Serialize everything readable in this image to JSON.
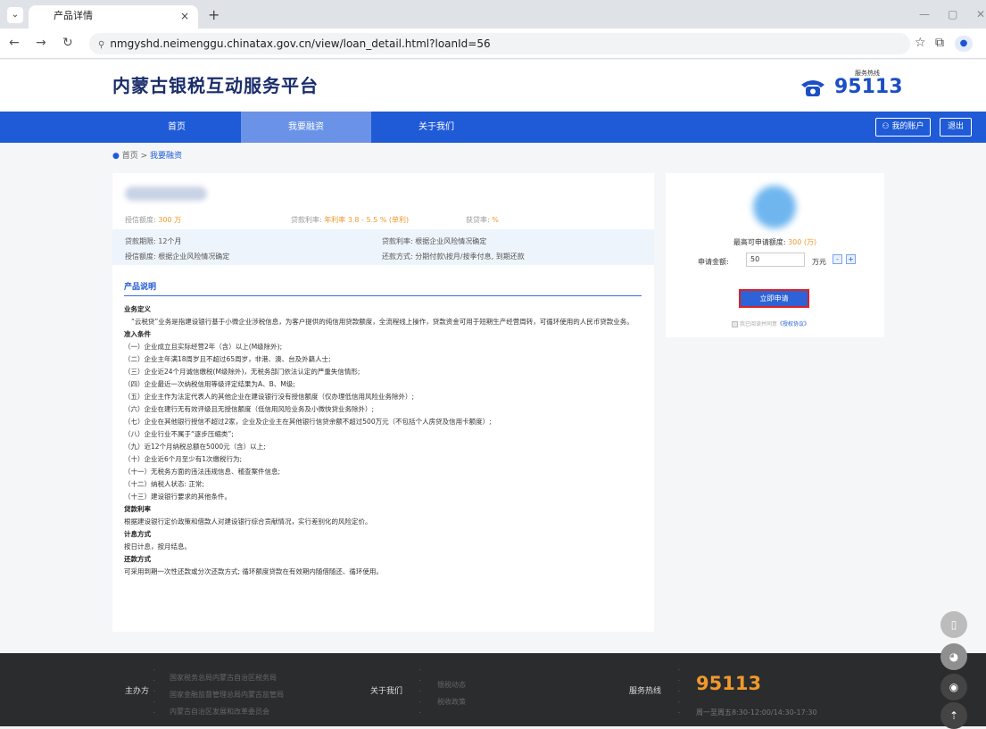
{
  "browser": {
    "tab_title": "产品详情",
    "tab_close": "×",
    "new_tab": "+",
    "url": "nmgyshd.neimenggu.chinatax.gov.cn/view/loan_detail.html?loanId=56"
  },
  "header": {
    "site_title": "内蒙古银税互动服务平台",
    "hotline_label": "服务热线",
    "hotline_number": "95113"
  },
  "nav": {
    "items": [
      "首页",
      "我要融资",
      "关于我们"
    ],
    "account": "我的账户",
    "logout": "退出"
  },
  "breadcrumb": {
    "home": "首页",
    "sep": ">",
    "current": "我要融资"
  },
  "product": {
    "stats": [
      {
        "label": "授信额度: ",
        "value": "300 万"
      },
      {
        "label": "贷款利率: ",
        "value": "年利率 3.8 - 5.5 % (单利)"
      },
      {
        "label": "获贷率: ",
        "value": "%"
      }
    ],
    "info": {
      "term": "贷款期限: 12个月",
      "rate": "贷款利率: 根据企业风险情况确定",
      "credit": "授信额度: 根据企业风险情况确定",
      "repay": "还款方式: 分期付款\\按月/按季付息, 到期还款"
    },
    "section_title": "产品说明",
    "def_title": "业务定义",
    "def_text": "“云税贷”业务是指建设银行基于小微企业涉税信息，为客户提供的纯信用贷款额度，全流程线上操作，贷款资金可用于短期生产经营周转，可循环使用的人民币贷款业务。",
    "cond_title": "准入条件",
    "conditions": [
      "（一）企业成立且实际经营2年（含）以上(M级除外);",
      "（二）企业主年满18周岁且不超过65周岁，非港、澳、台及外籍人士;",
      "（三）企业近24个月诚信缴税(M级除外)，无税务部门依法认定的严重失信情形;",
      "（四）企业最近一次纳税信用等级评定结果为A、B、M级;",
      "（五）企业主作为法定代表人的其他企业在建设银行没有授信额度（仅办理低信用风险业务除外）;",
      "（六）企业在建行无有效评级且无授信额度（低信用风险业务及小微快贷业务除外）;",
      "（七）企业在其他银行授信不超过2家，企业及企业主在其他银行信贷余额不超过500万元（不包括个人房贷及信用卡额度）;",
      "（八）企业行业不属于“逐步压缩类”;",
      "（九）近12个月纳税总额在5000元（含）以上;",
      "（十）企业近6个月至少有1次缴税行为;",
      "（十一）无税务方面的违法违规信息、稽查案件信息;",
      "（十二）纳税人状态: 正常;",
      "（十三）建设银行要求的其他条件。"
    ],
    "rate_title": "贷款利率",
    "rate_text": "根据建设银行定价政策和借款人对建设银行综合贡献情况，实行差别化的风险定价。",
    "interest_title": "计息方式",
    "interest_text": "按日计息，按月结息。",
    "repay_title": "还款方式",
    "repay_text": "可采用到期一次性还款或分次还款方式; 循环额度贷款在有效期内随借随还、循环使用。"
  },
  "apply": {
    "max_label": "最高可申请额度: ",
    "max_value": "300 (万)",
    "amount_label": "申请金额: ",
    "amount_value": "50",
    "amount_unit": "万元",
    "minus": "-",
    "plus": "+",
    "button": "立即申请",
    "agree_text": "我已阅读并同意",
    "agree_link": "《授权协议》"
  },
  "footer": {
    "organizer_label": "主办方",
    "organizers": [
      "国家税务总局内蒙古自治区税务局",
      "国家金融监督管理总局内蒙古监管局",
      "内蒙古自治区发展和改革委员会"
    ],
    "about_label": "关于我们",
    "about_links": [
      "银税动态",
      "税收政策"
    ],
    "hotline_label": "服务热线",
    "hotline_number": "95113",
    "hours": "周一至周五8:30-12:00/14:30-17:30"
  }
}
